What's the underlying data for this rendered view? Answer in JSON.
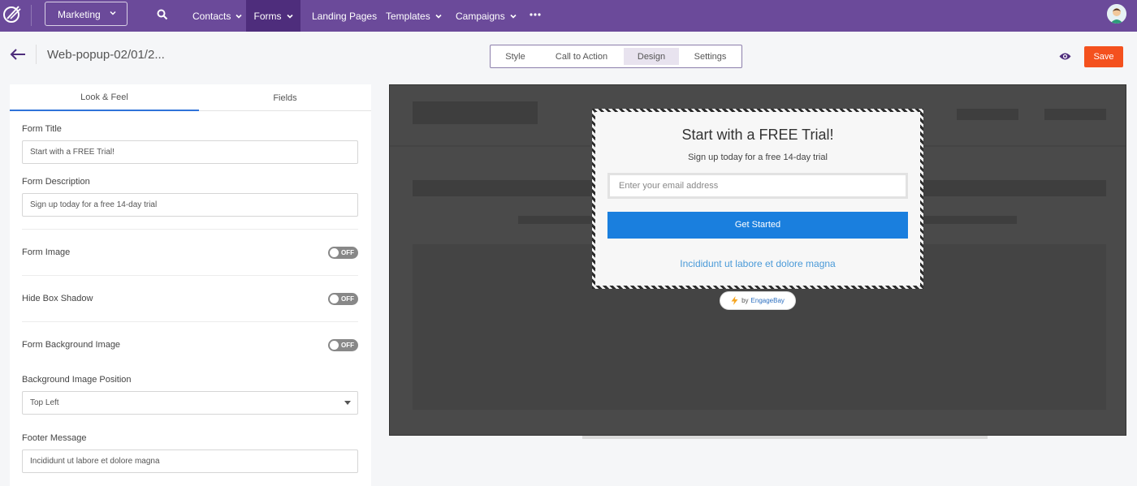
{
  "nav": {
    "app_select": "Marketing",
    "items": [
      {
        "label": "Contacts",
        "has_caret": true
      },
      {
        "label": "Forms",
        "has_caret": true,
        "active": true
      },
      {
        "label": "Landing Pages",
        "has_caret": false
      },
      {
        "label": "Templates",
        "has_caret": true
      },
      {
        "label": "Campaigns",
        "has_caret": true
      }
    ],
    "icons": [
      "logo-icon",
      "search-icon",
      "more-icon",
      "avatar"
    ]
  },
  "header": {
    "doc_title": "Web-popup-02/01/2...",
    "tabs": [
      "Style",
      "Call to Action",
      "Design",
      "Settings"
    ],
    "active_tab": "Design",
    "save_label": "Save",
    "save_color": "#f4511e"
  },
  "panel": {
    "tabs": [
      "Look & Feel",
      "Fields"
    ],
    "active_tab": "Look & Feel",
    "form_title_label": "Form Title",
    "form_title_value": "Start with a FREE Trial!",
    "form_desc_label": "Form Description",
    "form_desc_value": "Sign up today for a free 14-day trial",
    "form_image_label": "Form Image",
    "hide_shadow_label": "Hide Box Shadow",
    "bg_image_label": "Form Background Image",
    "toggle_off": "OFF",
    "bg_position_label": "Background Image Position",
    "bg_position_value": "Top Left",
    "footer_label": "Footer Message",
    "footer_value": "Incididunt ut labore et dolore magna"
  },
  "preview": {
    "title": "Start with a FREE Trial!",
    "description": "Sign up today for a free 14-day trial",
    "email_placeholder": "Enter your email address",
    "button_label": "Get Started",
    "button_color": "#1a7fde",
    "footer_link": "Incididunt ut labore et dolore magna",
    "badge_by": "by",
    "badge_brand": "EngageBay"
  }
}
